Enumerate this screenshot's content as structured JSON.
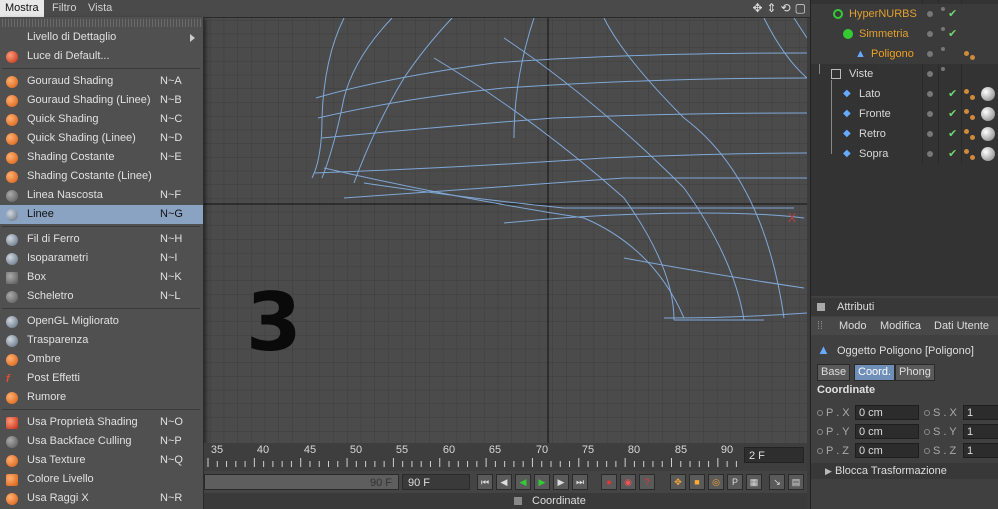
{
  "menubar": {
    "items": [
      "Mostra",
      "Filtro",
      "Vista"
    ],
    "active": "Mostra"
  },
  "dropdown": {
    "items": [
      {
        "label": "Livello di Dettaglio",
        "shortcut": "",
        "icon": "none",
        "submenu": true
      },
      {
        "label": "Luce di Default...",
        "shortcut": "",
        "icon": "light-icon"
      },
      {
        "label": "Gouraud Shading",
        "shortcut": "N~A",
        "icon": "shading-sphere-icon"
      },
      {
        "label": "Gouraud Shading (Linee)",
        "shortcut": "N~B",
        "icon": "shading-sphere-icon"
      },
      {
        "label": "Quick Shading",
        "shortcut": "N~C",
        "icon": "shading-sphere-icon"
      },
      {
        "label": "Quick Shading (Linee)",
        "shortcut": "N~D",
        "icon": "shading-sphere-icon"
      },
      {
        "label": "Shading Costante",
        "shortcut": "N~E",
        "icon": "shading-sphere-icon"
      },
      {
        "label": "Shading Costante (Linee)",
        "shortcut": "",
        "icon": "shading-sphere-icon"
      },
      {
        "label": "Linea Nascosta",
        "shortcut": "N~F",
        "icon": "hidden-line-icon"
      },
      {
        "label": "Linee",
        "shortcut": "N~G",
        "icon": "wire-globe-icon",
        "highlighted": true
      },
      {
        "label": "Fil di Ferro",
        "shortcut": "N~H",
        "icon": "wire-globe-icon"
      },
      {
        "label": "Isoparametri",
        "shortcut": "N~I",
        "icon": "wire-globe-icon"
      },
      {
        "label": "Box",
        "shortcut": "N~K",
        "icon": "box-icon"
      },
      {
        "label": "Scheletro",
        "shortcut": "N~L",
        "icon": "skeleton-icon"
      },
      {
        "label": "OpenGL Migliorato",
        "shortcut": "",
        "icon": "opengl-icon"
      },
      {
        "label": "Trasparenza",
        "shortcut": "",
        "icon": "transparency-icon"
      },
      {
        "label": "Ombre",
        "shortcut": "",
        "icon": "shadow-icon"
      },
      {
        "label": "Post Effetti",
        "shortcut": "",
        "icon": "post-effects-icon"
      },
      {
        "label": "Rumore",
        "shortcut": "",
        "icon": "noise-icon"
      },
      {
        "label": "Usa Proprietà Shading",
        "shortcut": "N~O",
        "icon": "shading-property-icon"
      },
      {
        "label": "Usa Backface Culling",
        "shortcut": "N~P",
        "icon": "backface-icon"
      },
      {
        "label": "Usa Texture",
        "shortcut": "N~Q",
        "icon": "texture-icon"
      },
      {
        "label": "Colore Livello",
        "shortcut": "",
        "icon": "layer-color-icon"
      },
      {
        "label": "Usa Raggi X",
        "shortcut": "N~R",
        "icon": "xray-icon"
      }
    ]
  },
  "viewport": {
    "overlay_number": "3"
  },
  "timeline": {
    "ticks": [
      "35",
      "40",
      "45",
      "50",
      "55",
      "60",
      "65",
      "70",
      "75",
      "80",
      "85",
      "90"
    ],
    "current_frame": "2 F"
  },
  "transport": {
    "field_end": "90 F",
    "field_max": "90 F"
  },
  "statusbar": {
    "label": "Coordinate"
  },
  "objects": {
    "rows": [
      {
        "name": "HyperNURBS",
        "color": "#e0a030"
      },
      {
        "name": "Simmetria",
        "color": "#e0a030"
      },
      {
        "name": "Poligono",
        "color": "#f0a020"
      },
      {
        "name": "Viste",
        "color": "#d8d8d8"
      },
      {
        "name": "Lato",
        "color": "#d8d8d8"
      },
      {
        "name": "Fronte",
        "color": "#d8d8d8"
      },
      {
        "name": "Retro",
        "color": "#d8d8d8"
      },
      {
        "name": "Sopra",
        "color": "#d8d8d8"
      }
    ]
  },
  "attributes": {
    "header": "Attributi",
    "menu": [
      "Modo",
      "Modifica",
      "Dati Utente"
    ],
    "object_name": "Oggetto Poligono [Poligono]",
    "tabs": [
      "Base",
      "Coord.",
      "Phong"
    ],
    "active_tab": "Coord.",
    "section": "Coordinate",
    "rows": [
      {
        "p_label": "P . X",
        "p_value": "0 cm",
        "s_label": "S . X",
        "s_value": "1"
      },
      {
        "p_label": "P . Y",
        "p_value": "0 cm",
        "s_label": "S . Y",
        "s_value": "1"
      },
      {
        "p_label": "P . Z",
        "p_value": "0 cm",
        "s_label": "S . Z",
        "s_value": "1"
      }
    ],
    "collapse_label": "Blocca Trasformazione"
  }
}
